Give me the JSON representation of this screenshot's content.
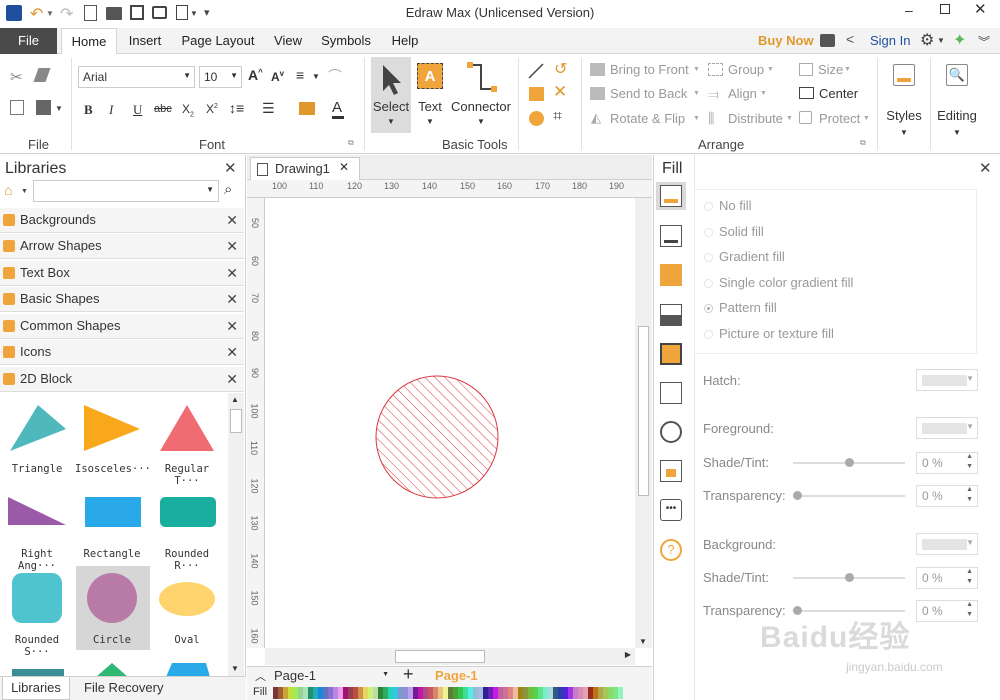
{
  "window": {
    "title": "Edraw Max (Unlicensed Version)"
  },
  "menu": {
    "file": "File",
    "tabs": [
      "Home",
      "Insert",
      "Page Layout",
      "View",
      "Symbols",
      "Help"
    ],
    "buy_now": "Buy Now",
    "sign_in": "Sign In"
  },
  "ribbon": {
    "font": {
      "name": "Arial",
      "size": "10",
      "group_label": "Font"
    },
    "file_group_label": "File",
    "tools": {
      "select": "Select",
      "text": "Text",
      "connector": "Connector",
      "group_label": "Basic Tools"
    },
    "arrange": {
      "bring_to_front": "Bring to Front",
      "send_to_back": "Send to Back",
      "rotate_flip": "Rotate & Flip",
      "group": "Group",
      "align": "Align",
      "distribute": "Distribute",
      "size": "Size",
      "center": "Center",
      "protect": "Protect",
      "group_label": "Arrange"
    },
    "styles": "Styles",
    "editing": "Editing"
  },
  "libraries": {
    "title": "Libraries",
    "search_placeholder": "",
    "items": [
      "Backgrounds",
      "Arrow Shapes",
      "Text Box",
      "Basic Shapes",
      "Common Shapes",
      "Icons",
      "2D Block"
    ],
    "shapes": [
      "Triangle",
      "Isosceles···",
      "Regular T···",
      "Right Ang···",
      "Rectangle",
      "Rounded R···",
      "Rounded S···",
      "Circle",
      "Oval"
    ],
    "bottom_tabs": [
      "Libraries",
      "File Recovery"
    ]
  },
  "document": {
    "tab": "Drawing1",
    "hruler": [
      "100",
      "110",
      "120",
      "130",
      "140",
      "150",
      "160",
      "170",
      "180",
      "190"
    ],
    "vruler": [
      "50",
      "60",
      "70",
      "80",
      "90",
      "100",
      "110",
      "120",
      "130",
      "140",
      "150",
      "160"
    ],
    "page_select": "Page-1",
    "page_tab": "Page-1",
    "fill_label": "Fill"
  },
  "fill_panel": {
    "title": "Fill",
    "options": [
      "No fill",
      "Solid fill",
      "Gradient fill",
      "Single color gradient fill",
      "Pattern fill",
      "Picture or texture fill"
    ],
    "selected": "Pattern fill",
    "hatch": "Hatch:",
    "foreground": "Foreground:",
    "shade_tint": "Shade/Tint:",
    "transparency": "Transparency:",
    "background": "Background:",
    "fg_shade": "0 %",
    "fg_transparency": "0 %",
    "bg_shade": "0 %",
    "bg_transparency": "0 %"
  },
  "watermark": {
    "text": "Baidu经验",
    "url": "jingyan.baidu.com"
  },
  "colors": {
    "accent": "#f0a53c",
    "circle_stroke": "#d9363e",
    "blue": "#1565c0"
  }
}
